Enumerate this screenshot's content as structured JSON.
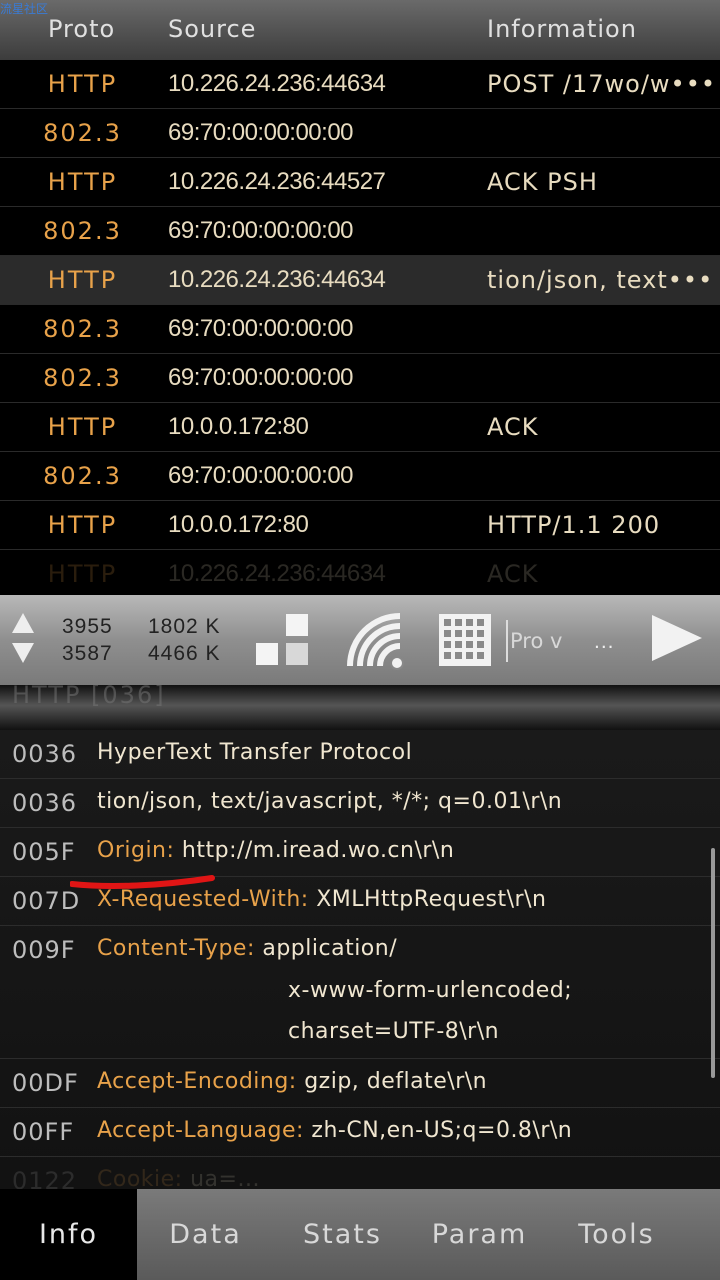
{
  "watermark": "流星社区",
  "header": {
    "proto": "Proto",
    "source": "Source",
    "info": "Information"
  },
  "packets": [
    {
      "proto": "HTTP",
      "source": "10.226.24.236:44634",
      "info": "POST /17wo/w•••",
      "selected": false
    },
    {
      "proto": "802.3",
      "source": "69:70:00:00:00:00",
      "info": ""
    },
    {
      "proto": "HTTP",
      "source": "10.226.24.236:44527",
      "info": "ACK PSH"
    },
    {
      "proto": "802.3",
      "source": "69:70:00:00:00:00",
      "info": ""
    },
    {
      "proto": "HTTP",
      "source": "10.226.24.236:44634",
      "info": "tion/json, text•••",
      "selected": true
    },
    {
      "proto": "802.3",
      "source": "69:70:00:00:00:00",
      "info": ""
    },
    {
      "proto": "802.3",
      "source": "69:70:00:00:00:00",
      "info": ""
    },
    {
      "proto": "HTTP",
      "source": "10.0.0.172:80",
      "info": "ACK"
    },
    {
      "proto": "802.3",
      "source": "69:70:00:00:00:00",
      "info": ""
    },
    {
      "proto": "HTTP",
      "source": "10.0.0.172:80",
      "info": "HTTP/1.1 200"
    }
  ],
  "ghost_packet": {
    "proto": "HTTP",
    "source": "10.226.24.236:44634",
    "info": "ACK"
  },
  "toolbar": {
    "up_packets": "3955",
    "up_size": "1802 K",
    "down_packets": "3587",
    "down_size": "4466 K",
    "filter_placeholder": "Pro v",
    "filter_more": "..."
  },
  "detail_head": "HTTP [036]",
  "details": [
    {
      "offset": "0036",
      "key": "",
      "value": "HyperText Transfer Protocol"
    },
    {
      "offset": "0036",
      "key": "",
      "value": "tion/json, text/javascript, */*; q=0.01\\r\\n"
    },
    {
      "offset": "005F",
      "key": "Origin:",
      "value": "http://m.iread.wo.cn\\r\\n"
    },
    {
      "offset": "007D",
      "key": "X-Requested-With:",
      "value": "XMLHttpRequest\\r\\n"
    },
    {
      "offset": "009F",
      "key": "Content-Type:",
      "value": "application/",
      "cont": [
        "x-www-form-urlencoded;",
        "charset=UTF-8\\r\\n"
      ]
    },
    {
      "offset": "00DF",
      "key": "Accept-Encoding:",
      "value": "gzip, deflate\\r\\n"
    },
    {
      "offset": "00FF",
      "key": "Accept-Language:",
      "value": "zh-CN,en-US;q=0.8\\r\\n"
    },
    {
      "offset": "0122",
      "key": "Cookie:",
      "value": "ua=...",
      "ghost": true
    }
  ],
  "tabs": [
    {
      "label": "Info",
      "active": true
    },
    {
      "label": "Data"
    },
    {
      "label": "Stats"
    },
    {
      "label": "Param"
    },
    {
      "label": "Tools"
    }
  ],
  "colors": {
    "accent_orange": "#e8a24a",
    "annotation_red": "#e01515"
  }
}
